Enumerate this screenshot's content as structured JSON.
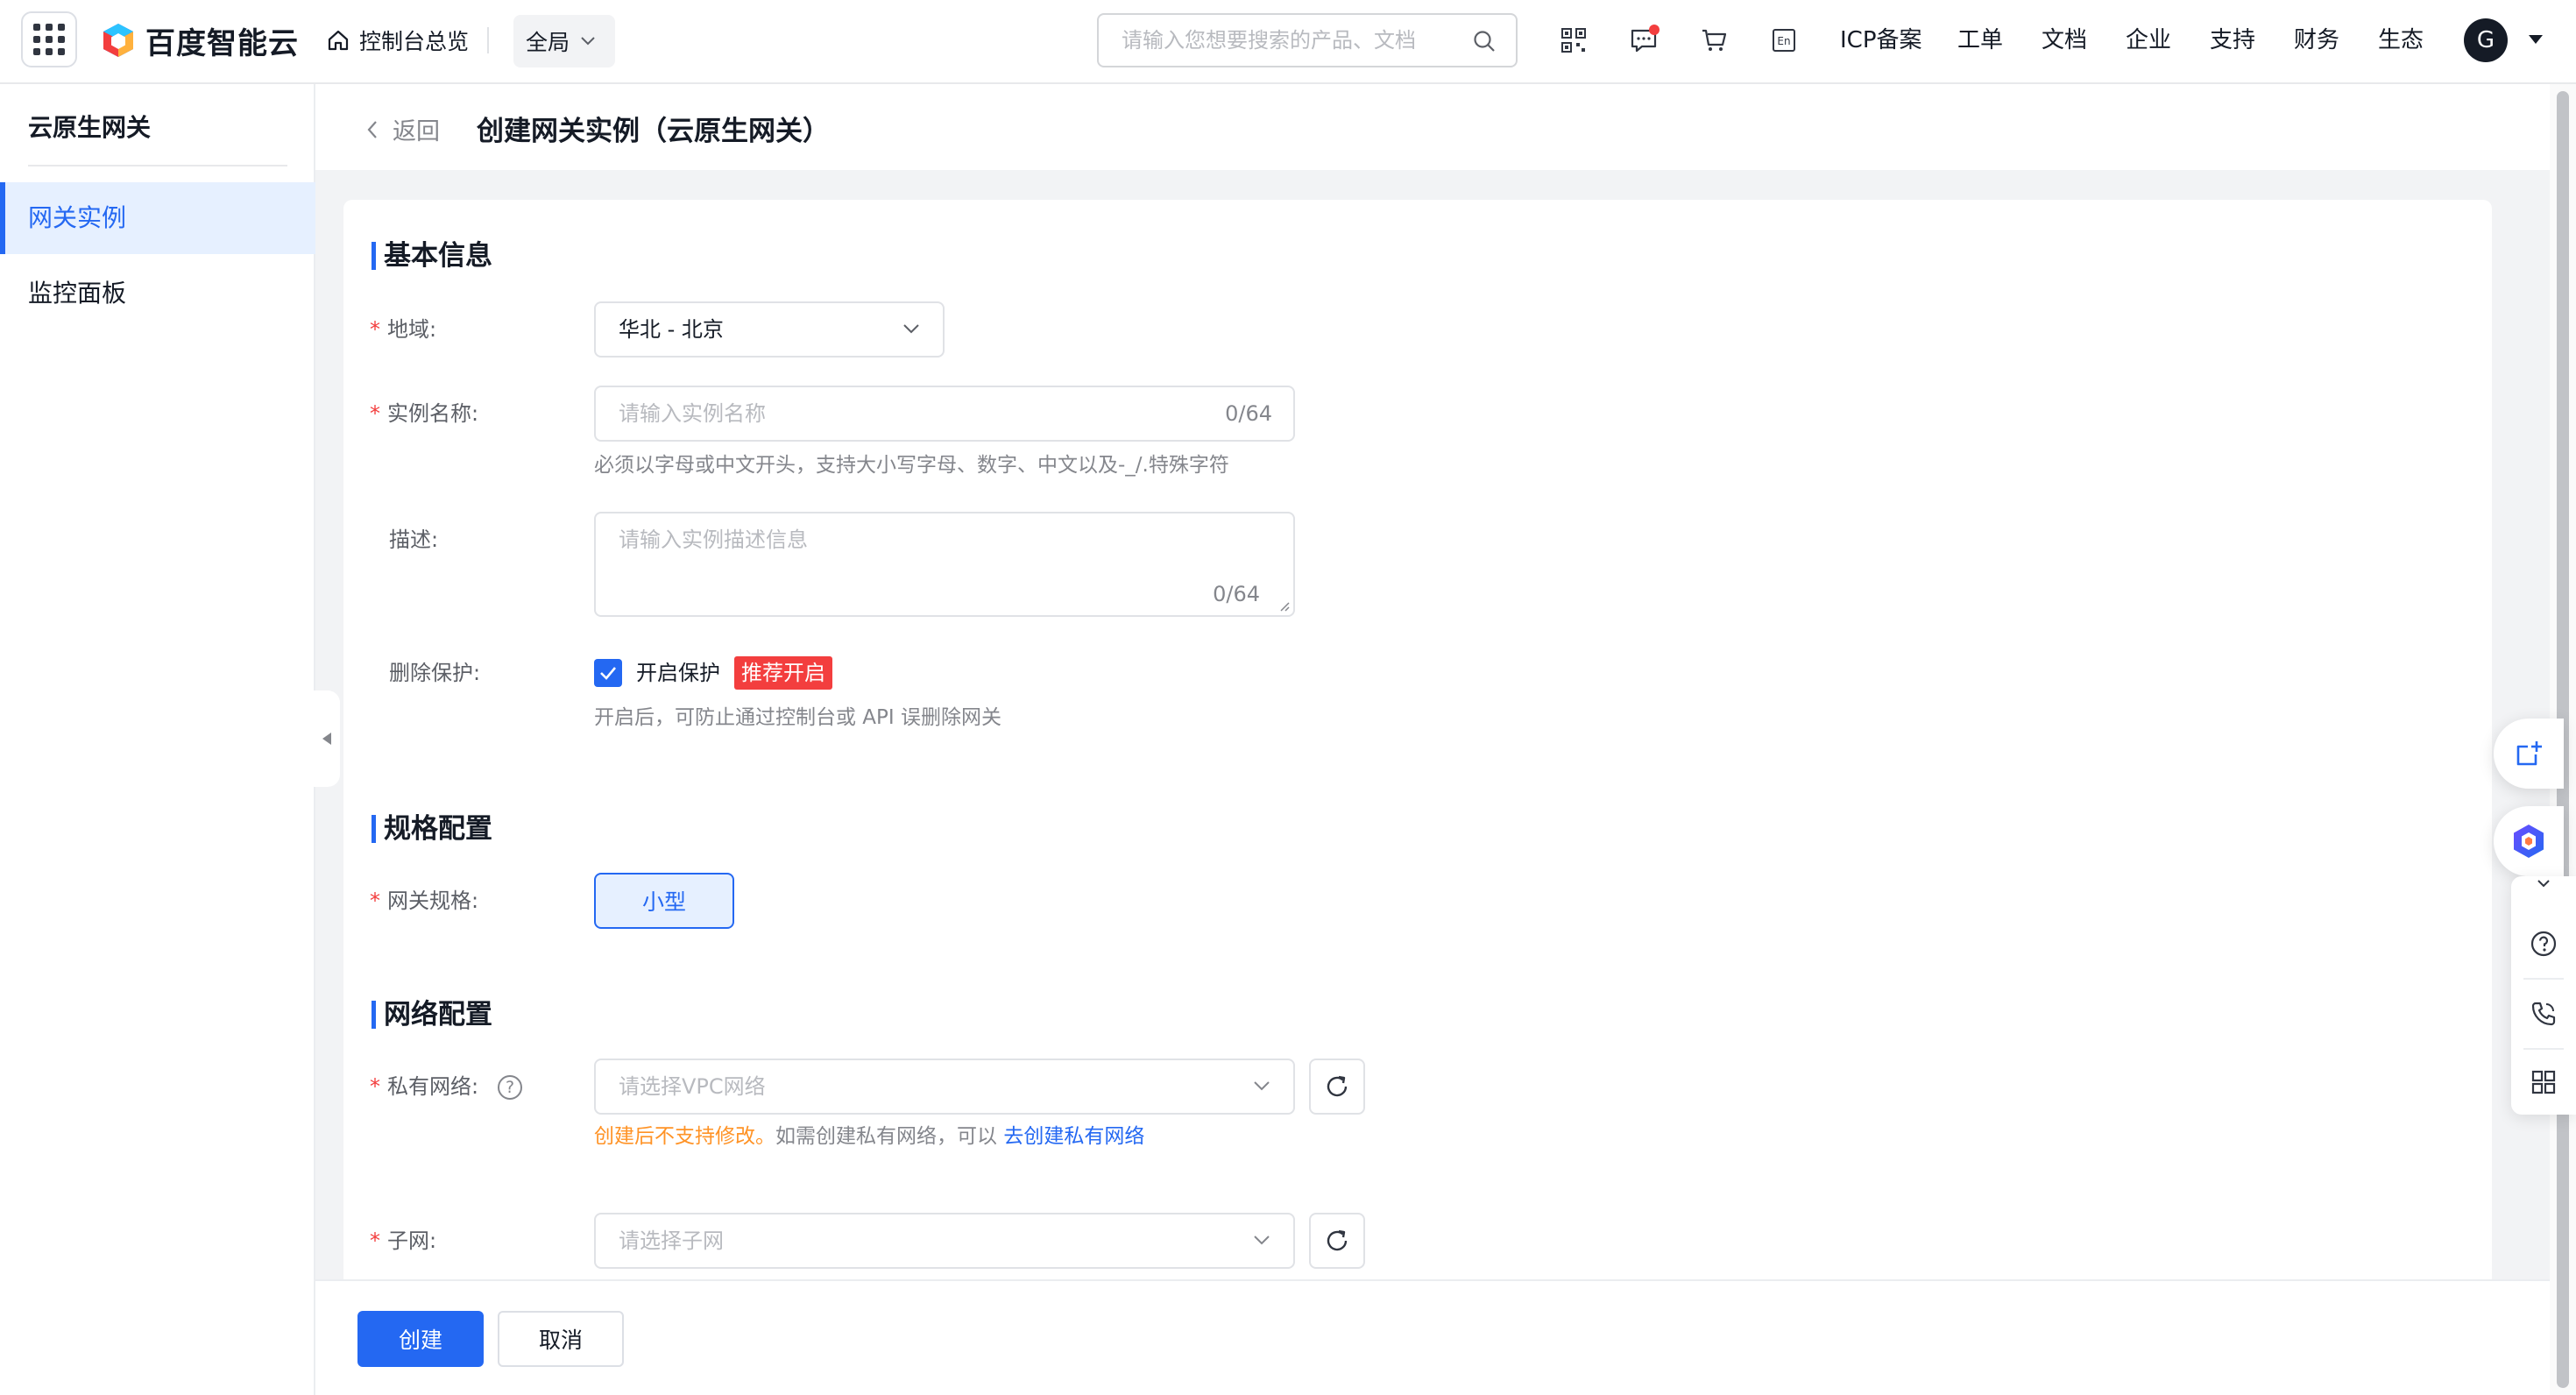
{
  "topbar": {
    "brand": "百度智能云",
    "home_label": "控制台总览",
    "scope_label": "全局",
    "search_placeholder": "请输入您想要搜索的产品、文档",
    "links": [
      "ICP备案",
      "工单",
      "文档",
      "企业",
      "支持",
      "财务",
      "生态"
    ],
    "avatar_letter": "G",
    "lang_badge": "En"
  },
  "sidebar": {
    "title": "云原生网关",
    "items": [
      {
        "label": "网关实例",
        "active": true
      },
      {
        "label": "监控面板",
        "active": false
      }
    ]
  },
  "page": {
    "back_label": "返回",
    "title": "创建网关实例（云原生网关）"
  },
  "form": {
    "basic": {
      "title": "基本信息",
      "region_label": "地域:",
      "region_value": "华北 - 北京",
      "name_label": "实例名称:",
      "name_placeholder": "请输入实例名称",
      "name_counter": "0/64",
      "name_hint": "必须以字母或中文开头，支持大小写字母、数字、中文以及-_/.特殊字符",
      "desc_label": "描述:",
      "desc_placeholder": "请输入实例描述信息",
      "desc_counter": "0/64",
      "protect_label": "删除保护:",
      "protect_checkbox_label": "开启保护",
      "protect_checked": true,
      "protect_badge": "推荐开启",
      "protect_hint": "开启后，可防止通过控制台或 API 误删除网关"
    },
    "spec": {
      "title": "规格配置",
      "spec_label": "网关规格:",
      "spec_option": "小型"
    },
    "network": {
      "title": "网络配置",
      "vpc_label": "私有网络:",
      "vpc_placeholder": "请选择VPC网络",
      "vpc_warn": "创建后不支持修改。",
      "vpc_hint": "如需创建私有网络，可以 ",
      "vpc_link": "去创建私有网络",
      "subnet_label": "子网:",
      "subnet_placeholder": "请选择子网"
    }
  },
  "footer": {
    "create_label": "创建",
    "cancel_label": "取消"
  },
  "colors": {
    "primary": "#2468f2",
    "danger": "#f33e3e",
    "warning": "#ff9326"
  }
}
